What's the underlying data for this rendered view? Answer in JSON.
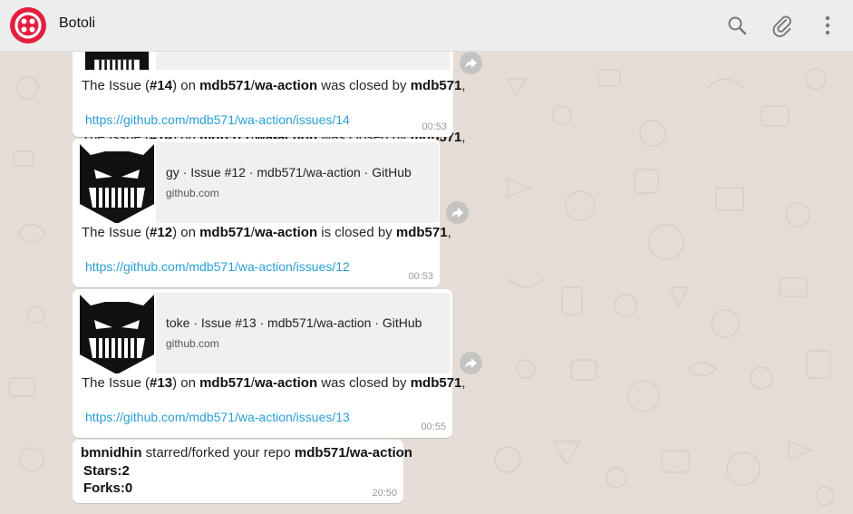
{
  "header": {
    "chat_name": "Botoli",
    "icons": [
      "logo-icon",
      "search-icon",
      "attach-icon",
      "menu-icon"
    ]
  },
  "messages": [
    {
      "type": "link",
      "text_parts": [
        "The Issue (",
        "#14",
        ") on ",
        "mdb571",
        "/",
        "wa-action",
        " was closed by ",
        "mdb571",
        ","
      ],
      "link": "https://github.com/mdb571/wa-action/issues/14",
      "time": "00:53"
    },
    {
      "type": "link",
      "preview_title": "gy · Issue #12 · mdb571/wa-action · GitHub",
      "preview_domain": "github.com",
      "text_parts": [
        "The Issue (",
        "#12",
        ") on ",
        "mdb571",
        "/",
        "wa-action",
        " is closed by ",
        "mdb571",
        ","
      ],
      "link": "https://github.com/mdb571/wa-action/issues/12",
      "time": "00:53"
    },
    {
      "type": "link",
      "preview_title": "toke · Issue #13 · mdb571/wa-action · GitHub",
      "preview_domain": "github.com",
      "text_parts": [
        "The Issue (",
        "#13",
        ") on ",
        "mdb571",
        "/",
        "wa-action",
        " was closed by ",
        "mdb571",
        ","
      ],
      "link": "https://github.com/mdb571/wa-action/issues/13",
      "time": "00:55"
    },
    {
      "type": "text",
      "line1_parts": [
        "bmnidhin",
        " starred/forked your repo ",
        "mdb571/wa-action"
      ],
      "line2": "Stars:2",
      "line3": "Forks:0",
      "time": "20:50"
    }
  ],
  "colors": {
    "header_bg": "#ededed",
    "chat_bg": "#e5ddd5",
    "link": "#2a9fd6",
    "logo": "#e31e3f"
  }
}
